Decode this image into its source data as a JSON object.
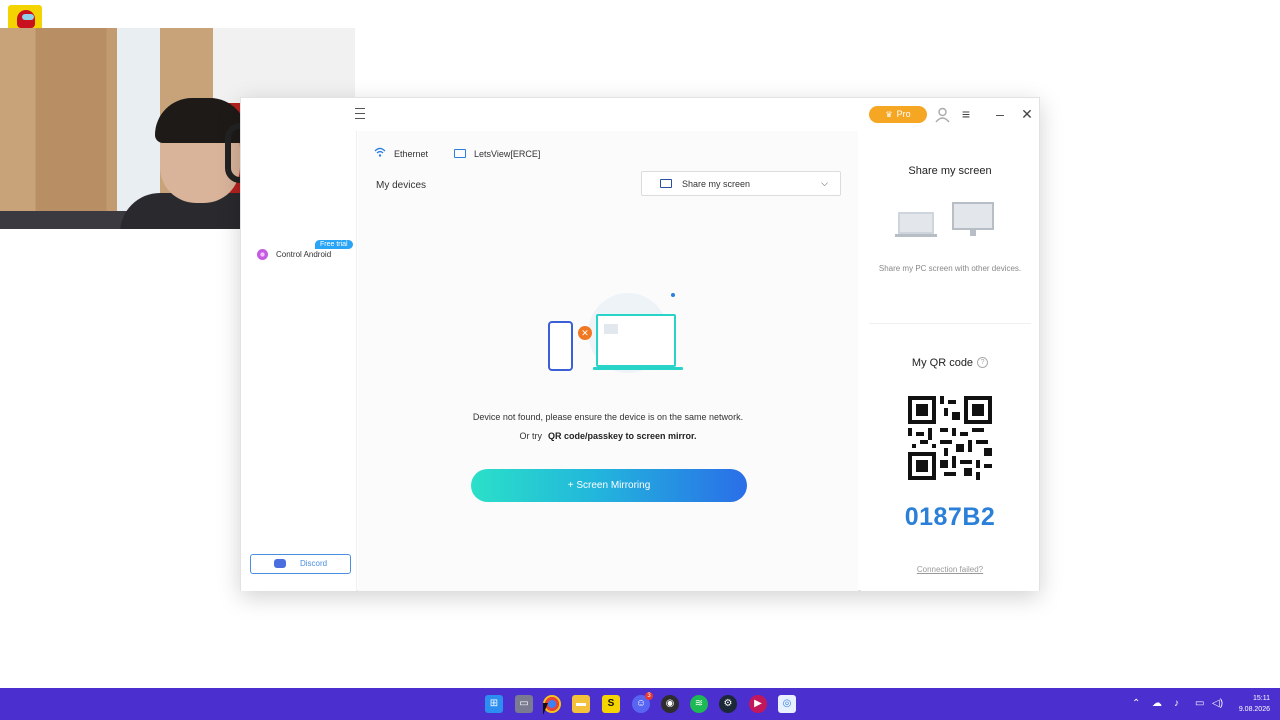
{
  "titlebar": {
    "pro_label": "Pro",
    "icons": [
      "menu-icon",
      "crown-icon",
      "user-icon",
      "hamburger-icon",
      "minimize-icon",
      "close-icon"
    ]
  },
  "network": {
    "items": [
      {
        "label": "Ethernet",
        "icon": "wifi-icon"
      },
      {
        "label": "LetsView[ERCE]",
        "icon": "monitor-icon"
      }
    ]
  },
  "main": {
    "my_devices": "My devices",
    "share_select_value": "Share my screen",
    "not_found": "Device not found, please ensure the device is on the same network.",
    "or_try": "Or try",
    "qr_link": "QR code/passkey to screen mirror.",
    "mirror_button": "+ Screen Mirroring"
  },
  "sidebar": {
    "control_android": "Control Android",
    "free_trial": "Free trial",
    "discord": "Discord"
  },
  "right": {
    "share_title": "Share my screen",
    "share_desc": "Share my PC screen with other devices.",
    "qr_title": "My QR code",
    "help": "?",
    "code": "0187B2",
    "connection_failed": "Connection failed?"
  },
  "taskbar": {
    "time": "15:11",
    "date": "9.08.2026",
    "badge": "3",
    "apps": [
      "windows-start-icon",
      "task-view-icon",
      "chrome-icon",
      "file-explorer-icon",
      "sublime-icon",
      "discord-icon",
      "obs-icon",
      "spotify-icon",
      "steam-icon",
      "media-player-icon",
      "letsview-icon"
    ],
    "tray": [
      "chevron-up-icon",
      "cloud-icon",
      "mic-icon",
      "network-icon",
      "volume-icon"
    ]
  },
  "colors": {
    "accent": "#2a7fd8",
    "pro": "#f5a623",
    "taskbar": "#4b2fcf",
    "gradient_start": "#2be0c8",
    "gradient_end": "#2a6ee8"
  }
}
